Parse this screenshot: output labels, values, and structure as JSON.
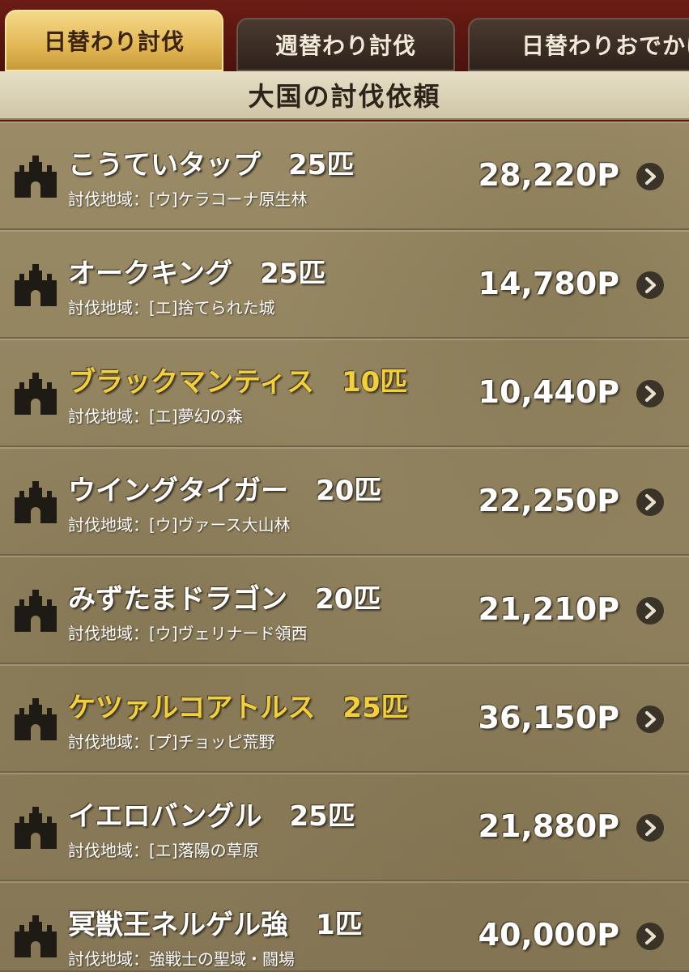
{
  "tabs": [
    {
      "label": "日替わり討伐"
    },
    {
      "label": "週替わり討伐"
    },
    {
      "label": "日替わりおでかけ"
    }
  ],
  "section": {
    "title": "大国の討伐依頼"
  },
  "rows": [
    {
      "name": "こうていタップ　25匹",
      "area": "討伐地域：[ウ]ケラコーナ原生林",
      "points": "28,220P",
      "highlight": false
    },
    {
      "name": "オークキング　25匹",
      "area": "討伐地域：[エ]捨てられた城",
      "points": "14,780P",
      "highlight": false
    },
    {
      "name": "ブラックマンティス　10匹",
      "area": "討伐地域：[エ]夢幻の森",
      "points": "10,440P",
      "highlight": true
    },
    {
      "name": "ウイングタイガー　20匹",
      "area": "討伐地域：[ウ]ヴァース大山林",
      "points": "22,250P",
      "highlight": false
    },
    {
      "name": "みずたまドラゴン　20匹",
      "area": "討伐地域：[ウ]ヴェリナード領西",
      "points": "21,210P",
      "highlight": false
    },
    {
      "name": "ケツァルコアトルス　25匹",
      "area": "討伐地域：[プ]チョッピ荒野",
      "points": "36,150P",
      "highlight": true
    },
    {
      "name": "イエロバングル　25匹",
      "area": "討伐地域：[エ]落陽の草原",
      "points": "21,880P",
      "highlight": false
    },
    {
      "name": "冥獣王ネルゲル強　1匹",
      "area": "討伐地域：強戦士の聖域・闘場",
      "points": "40,000P",
      "highlight": false
    }
  ],
  "icons": {
    "row_icon": "castle-icon",
    "row_action": "chevron-right-icon"
  },
  "colors": {
    "highlight": "#f3cf3a",
    "tab_active": "#e2b753"
  }
}
